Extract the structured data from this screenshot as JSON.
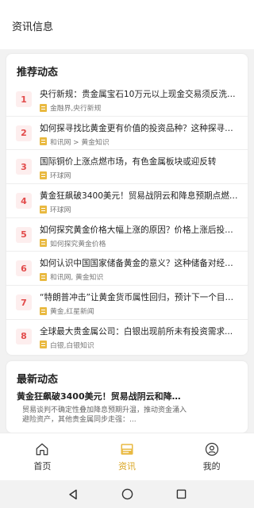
{
  "header": {
    "title": "资讯信息"
  },
  "recommended": {
    "title": "推荐动态",
    "items": [
      {
        "rank": "1",
        "title": "央行新规：贵金属宝石10万元以上现金交易须反洗钱...",
        "source": "金融界,央行新规"
      },
      {
        "rank": "2",
        "title": "如何探寻找比黄金更有价值的投资品种？这种探寻需要...",
        "source": "和讯网 > 黄金知识"
      },
      {
        "rank": "3",
        "title": "国际铜价上涨点燃市场，有色金属板块或迎反转",
        "source": "环球网"
      },
      {
        "rank": "4",
        "title": "黄金狂飙破3400美元！贸易战阴云和降息预期点燃避险...",
        "source": "环球网"
      },
      {
        "rank": "5",
        "title": "如何探究黄金价格大幅上涨的原因？价格上涨后投资者...",
        "source": "如何探究黄金价格"
      },
      {
        "rank": "6",
        "title": "如何认识中国国家储备黄金的意义？这种储备对经济有...",
        "source": "和讯网, 黄金知识"
      },
      {
        "rank": "7",
        "title": "“特朗普冲击”让黄金货币属性回归，预计下一个目标...",
        "source": "黄金,红星新闻"
      },
      {
        "rank": "8",
        "title": "全球最大贵金属公司：白银出现前所未有投资需求...",
        "source": "白银,白银知识"
      }
    ]
  },
  "latest": {
    "title": "最新动态",
    "item_title": "黄金狂飙破3400美元！贸易战阴云和降息预期点燃避险...",
    "item_summary": "贸易谈判不确定性叠加降息预期升温，推动资金涌入避险资产，其他贵金属同步走强：..."
  },
  "tabbar": {
    "tabs": [
      {
        "label": "首页",
        "icon": "home-icon",
        "active": false
      },
      {
        "label": "资讯",
        "icon": "news-icon",
        "active": true
      },
      {
        "label": "我的",
        "icon": "profile-icon",
        "active": false
      }
    ]
  },
  "navbar": {
    "icons": [
      "back-icon",
      "home-circle-icon",
      "recents-icon"
    ]
  },
  "colors": {
    "accent": "#d9a520",
    "rank_text": "#e24b4b",
    "rank_bg": "#fdeeee",
    "source_icon": "#e9b940"
  }
}
